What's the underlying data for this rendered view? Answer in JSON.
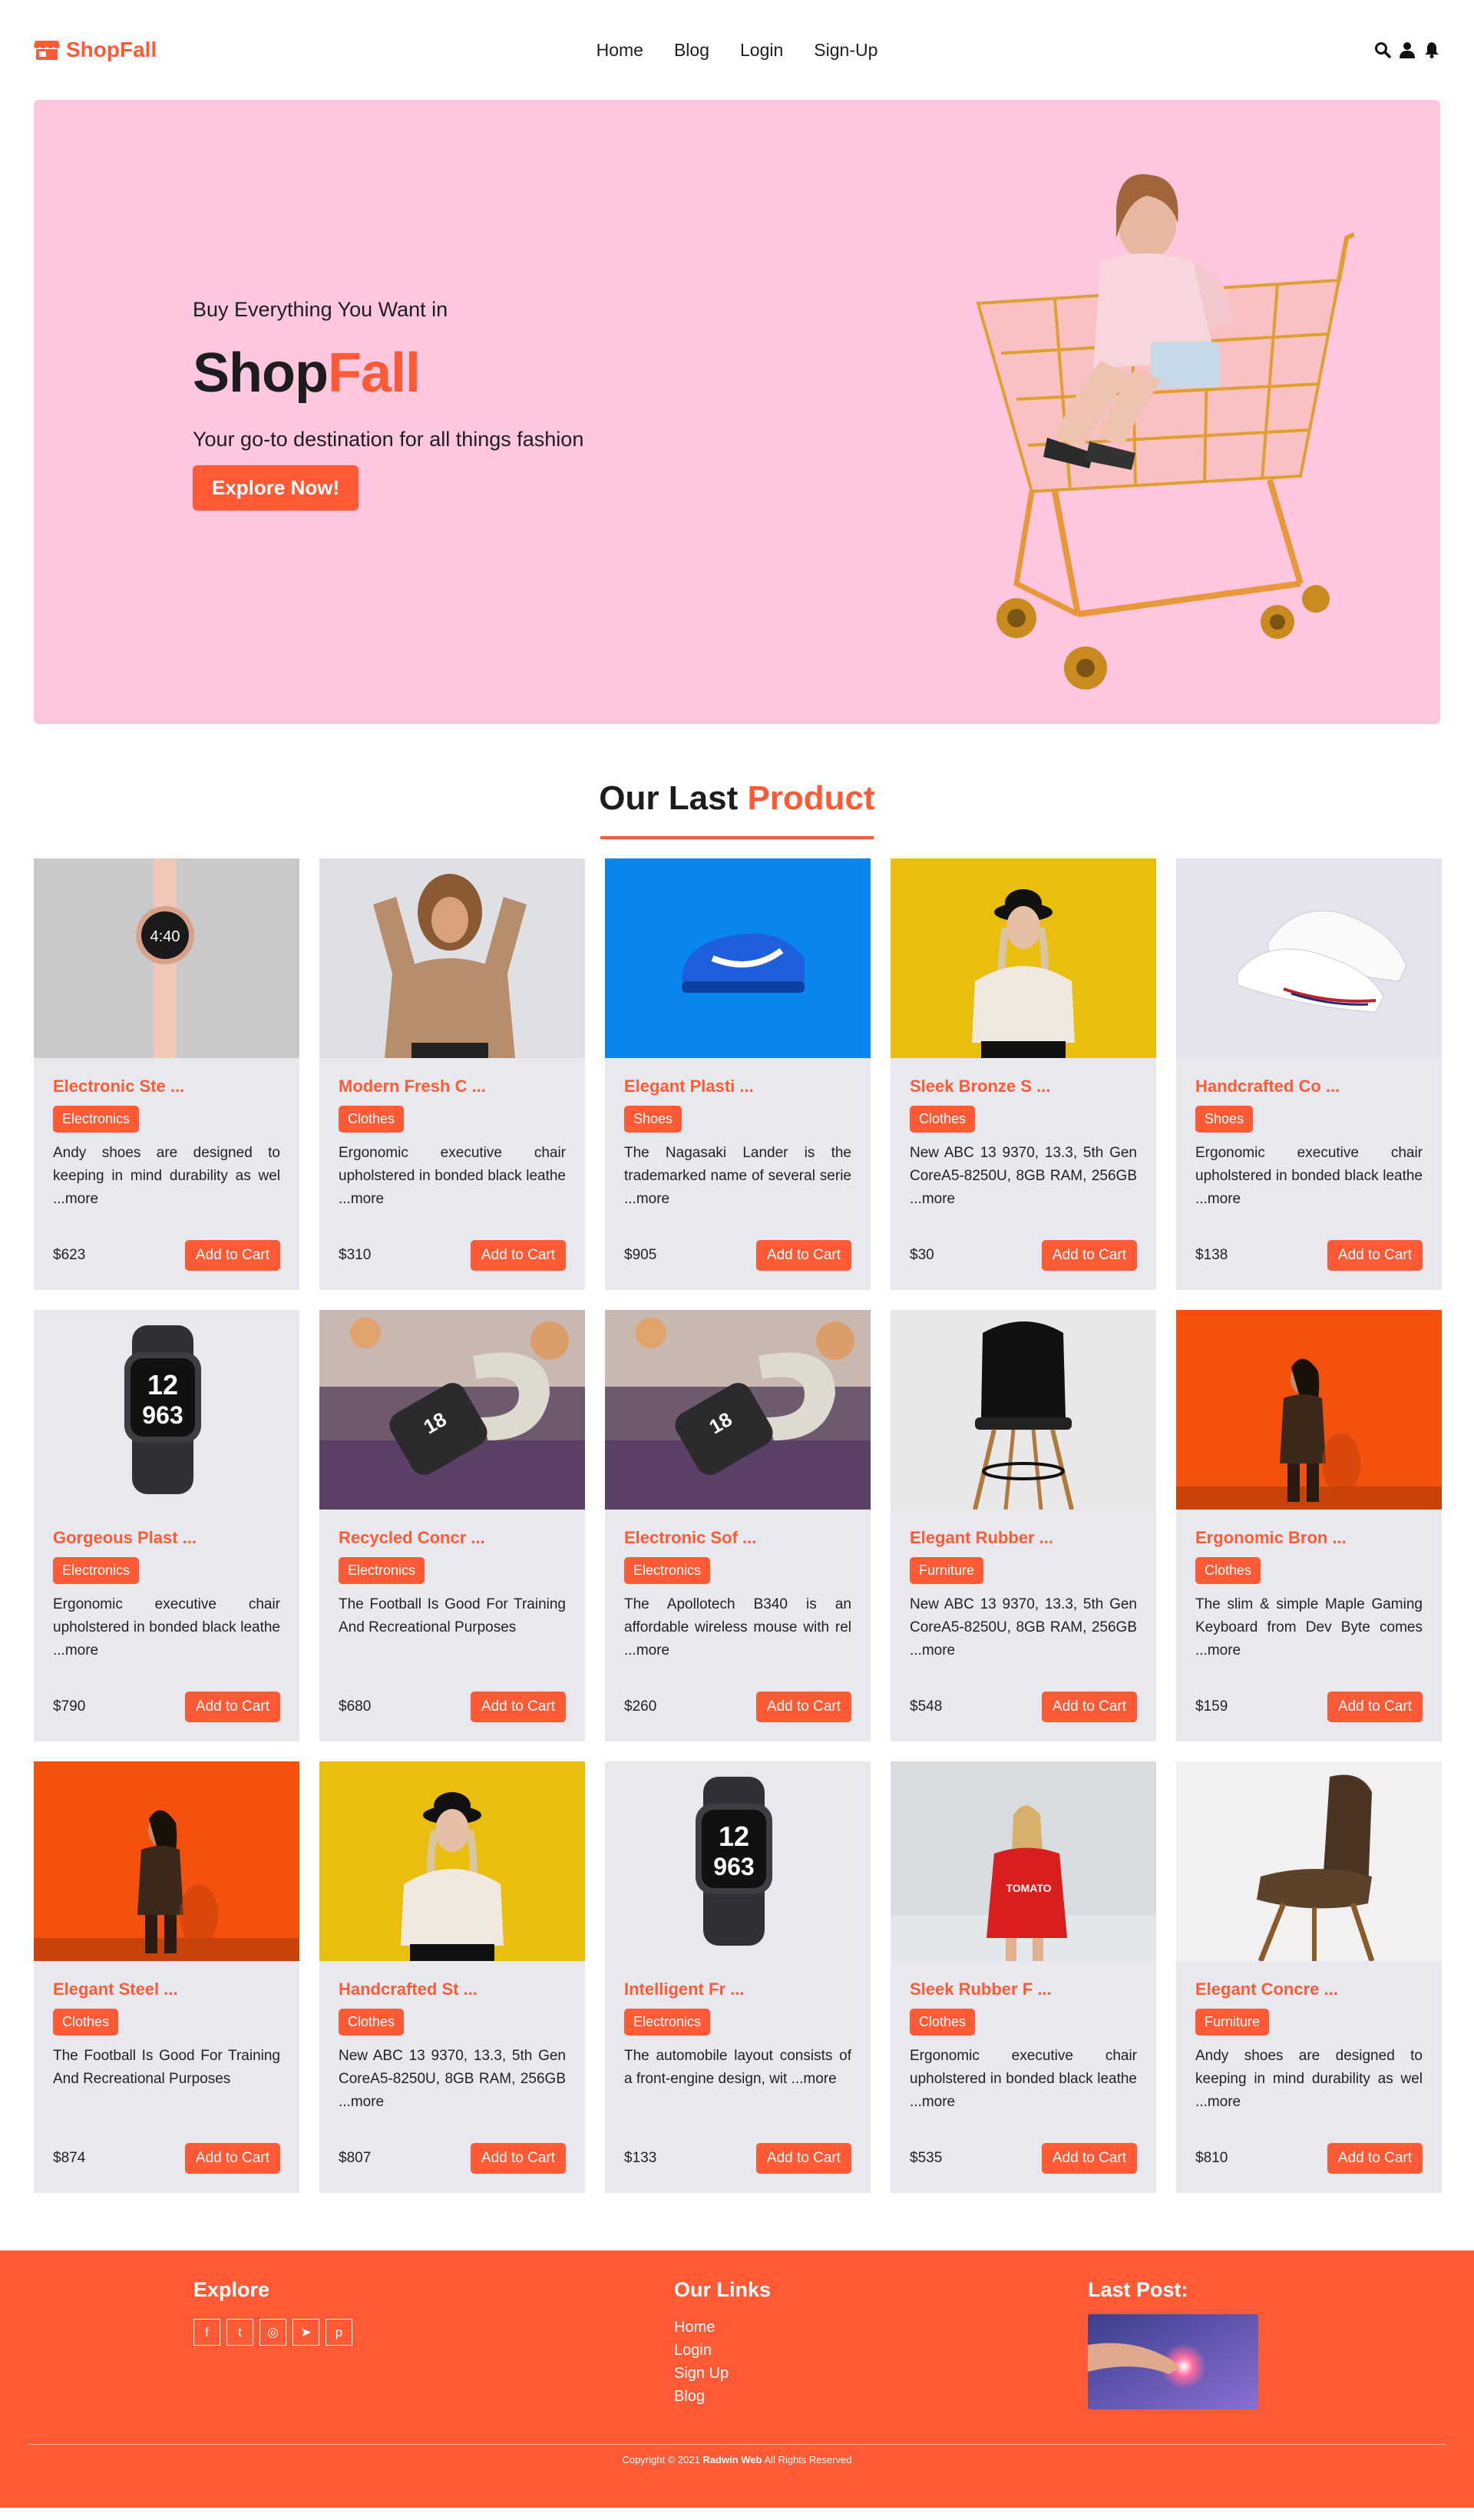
{
  "brand": {
    "name": "ShopFall",
    "accent": "#ff5a36"
  },
  "nav": [
    "Home",
    "Blog",
    "Login",
    "Sign-Up"
  ],
  "header_icons": [
    "search-icon",
    "user-icon",
    "bell-icon"
  ],
  "hero": {
    "subtitle": "Buy Everything You Want in",
    "title_main": "Shop",
    "title_accent": "Fall",
    "description": "Your go-to destination for all things fashion",
    "button": "Explore Now!",
    "background": "#ffc7df"
  },
  "section": {
    "title_main": "Our Last",
    "title_accent": "Product"
  },
  "products": [
    {
      "title": "Electronic Ste ...",
      "category": "Electronics",
      "desc": "Andy shoes are designed to keeping in mind durability as wel ...more",
      "price": "$623",
      "button": "Add to Cart",
      "image": "watch-gray"
    },
    {
      "title": "Modern Fresh C ...",
      "category": "Clothes",
      "desc": "Ergonomic executive chair upholstered in bonded black leathe ...more",
      "price": "$310",
      "button": "Add to Cart",
      "image": "woman-sweater"
    },
    {
      "title": "Elegant Plasti ...",
      "category": "Shoes",
      "desc": "The Nagasaki Lander is the trademarked name of several serie ...more",
      "price": "$905",
      "button": "Add to Cart",
      "image": "blue-shoe"
    },
    {
      "title": "Sleek Bronze S ...",
      "category": "Clothes",
      "desc": "New ABC 13 9370, 13.3, 5th Gen CoreA5-8250U, 8GB RAM, 256GB ...more",
      "price": "$30",
      "button": "Add to Cart",
      "image": "woman-yellow"
    },
    {
      "title": "Handcrafted Co ...",
      "category": "Shoes",
      "desc": "Ergonomic executive chair upholstered in bonded black leathe ...more",
      "price": "$138",
      "button": "Add to Cart",
      "image": "white-sneakers"
    },
    {
      "title": "Gorgeous Plast ...",
      "category": "Electronics",
      "desc": "Ergonomic executive chair upholstered in bonded black leathe ...more",
      "price": "$790",
      "button": "Add to Cart",
      "image": "smartwatch"
    },
    {
      "title": "Recycled Concr ...",
      "category": "Electronics",
      "desc": "The Football Is Good For Training And Recreational Purposes",
      "price": "$680",
      "button": "Add to Cart",
      "image": "watch-desk"
    },
    {
      "title": "Electronic Sof ...",
      "category": "Electronics",
      "desc": "The Apollotech B340 is an affordable wireless mouse with rel ...more",
      "price": "$260",
      "button": "Add to Cart",
      "image": "watch-desk"
    },
    {
      "title": "Elegant Rubber ...",
      "category": "Furniture",
      "desc": "New ABC 13 9370, 13.3, 5th Gen CoreA5-8250U, 8GB RAM, 256GB ...more",
      "price": "$548",
      "button": "Add to Cart",
      "image": "black-chair"
    },
    {
      "title": "Ergonomic Bron ...",
      "category": "Clothes",
      "desc": "The slim & simple Maple Gaming Keyboard from Dev Byte comes ...more",
      "price": "$159",
      "button": "Add to Cart",
      "image": "woman-orange"
    },
    {
      "title": "Elegant Steel ...",
      "category": "Clothes",
      "desc": "The Football Is Good For Training And Recreational Purposes",
      "price": "$874",
      "button": "Add to Cart",
      "image": "woman-orange"
    },
    {
      "title": "Handcrafted St ...",
      "category": "Clothes",
      "desc": "New ABC 13 9370, 13.3, 5th Gen CoreA5-8250U, 8GB RAM, 256GB ...more",
      "price": "$807",
      "button": "Add to Cart",
      "image": "woman-yellow"
    },
    {
      "title": "Intelligent Fr ...",
      "category": "Electronics",
      "desc": "The automobile layout consists of a front-engine design, wit ...more",
      "price": "$133",
      "button": "Add to Cart",
      "image": "smartwatch"
    },
    {
      "title": "Sleek Rubber F ...",
      "category": "Clothes",
      "desc": "Ergonomic executive chair upholstered in bonded black leathe ...more",
      "price": "$535",
      "button": "Add to Cart",
      "image": "woman-red"
    },
    {
      "title": "Elegant Concre ...",
      "category": "Furniture",
      "desc": "Andy shoes are designed to keeping in mind durability as wel ...more",
      "price": "$810",
      "button": "Add to Cart",
      "image": "brown-chair"
    }
  ],
  "footer": {
    "explore_title": "Explore",
    "social": [
      {
        "icon": "facebook-icon",
        "glyph": "f"
      },
      {
        "icon": "twitter-icon",
        "glyph": "t"
      },
      {
        "icon": "instagram-icon",
        "glyph": "◎"
      },
      {
        "icon": "telegram-icon",
        "glyph": "➤"
      },
      {
        "icon": "pinterest-icon",
        "glyph": "p"
      }
    ],
    "links_title": "Our Links",
    "links": [
      "Home",
      "Login",
      "Sign Up",
      "Blog"
    ],
    "post_title": "Last Post:",
    "copyright_pre": "Copyright © 2021",
    "copyright_brand": "Radwin Web",
    "copyright_post": "All Rights Reserved"
  }
}
